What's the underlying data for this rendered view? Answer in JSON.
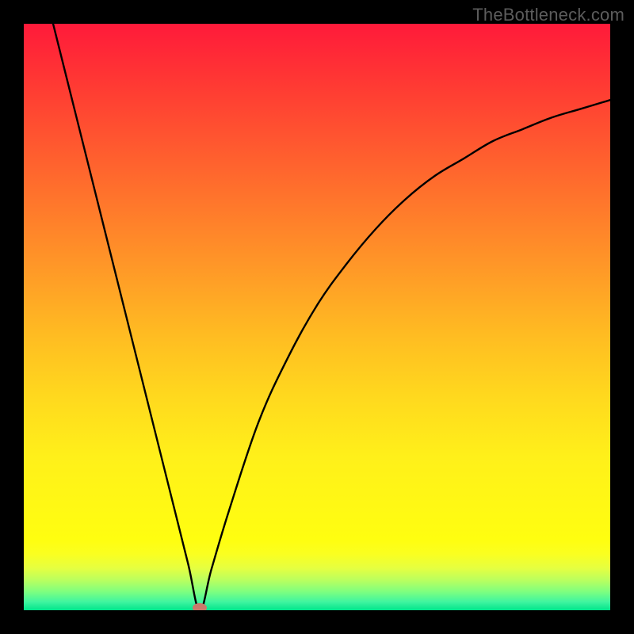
{
  "watermark": "TheBottleneck.com",
  "chart_data": {
    "type": "line",
    "title": "",
    "xlabel": "",
    "ylabel": "",
    "xlim": [
      0,
      100
    ],
    "ylim": [
      0,
      100
    ],
    "marker": {
      "x": 30,
      "y": 0,
      "color": "#c97a6b"
    },
    "series": [
      {
        "name": "curve",
        "x": [
          5,
          10,
          15,
          20,
          25,
          28,
          30,
          32,
          35,
          40,
          45,
          50,
          55,
          60,
          65,
          70,
          75,
          80,
          85,
          90,
          95,
          100
        ],
        "y": [
          100,
          80,
          60,
          40,
          20,
          8,
          0,
          7,
          17,
          32,
          43,
          52,
          59,
          65,
          70,
          74,
          77,
          80,
          82,
          84,
          85.5,
          87
        ]
      }
    ],
    "background_gradient": {
      "top_color": "#ff1a3a",
      "mid_color": "#fff01a",
      "bottom_color": "#00e58b"
    }
  }
}
